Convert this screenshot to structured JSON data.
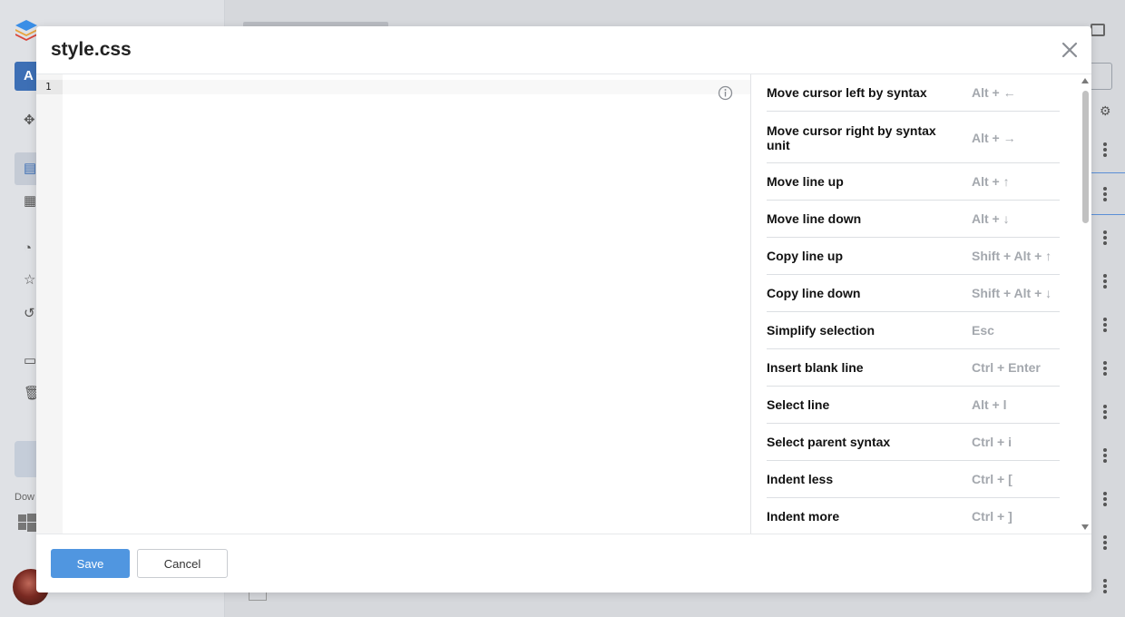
{
  "modal": {
    "title": "style.css",
    "close_icon": "close-icon"
  },
  "editor": {
    "line_numbers": [
      "1"
    ],
    "content": "",
    "info_icon": "info-icon"
  },
  "shortcuts": [
    {
      "label": "Move cursor left by syntax",
      "keys": "Alt + ←"
    },
    {
      "label": "Move cursor right by syntax unit",
      "keys": "Alt + →"
    },
    {
      "label": "Move line up",
      "keys": "Alt + ↑"
    },
    {
      "label": "Move line down",
      "keys": "Alt + ↓"
    },
    {
      "label": "Copy line up",
      "keys": "Shift + Alt + ↑"
    },
    {
      "label": "Copy line down",
      "keys": "Shift + Alt + ↓"
    },
    {
      "label": "Simplify selection",
      "keys": "Esc"
    },
    {
      "label": "Insert blank line",
      "keys": "Ctrl + Enter"
    },
    {
      "label": "Select line",
      "keys": "Alt + l"
    },
    {
      "label": "Select parent syntax",
      "keys": "Ctrl + i"
    },
    {
      "label": "Indent less",
      "keys": "Ctrl + ["
    },
    {
      "label": "Indent more",
      "keys": "Ctrl + ]"
    }
  ],
  "footer": {
    "save_label": "Save",
    "cancel_label": "Cancel"
  },
  "background": {
    "add_button_label": "A",
    "download_label": "Dow",
    "colors": {
      "accent": "#5096e0",
      "sidebar": "#dfe1e5",
      "overlay": "#d6d8dc"
    }
  }
}
